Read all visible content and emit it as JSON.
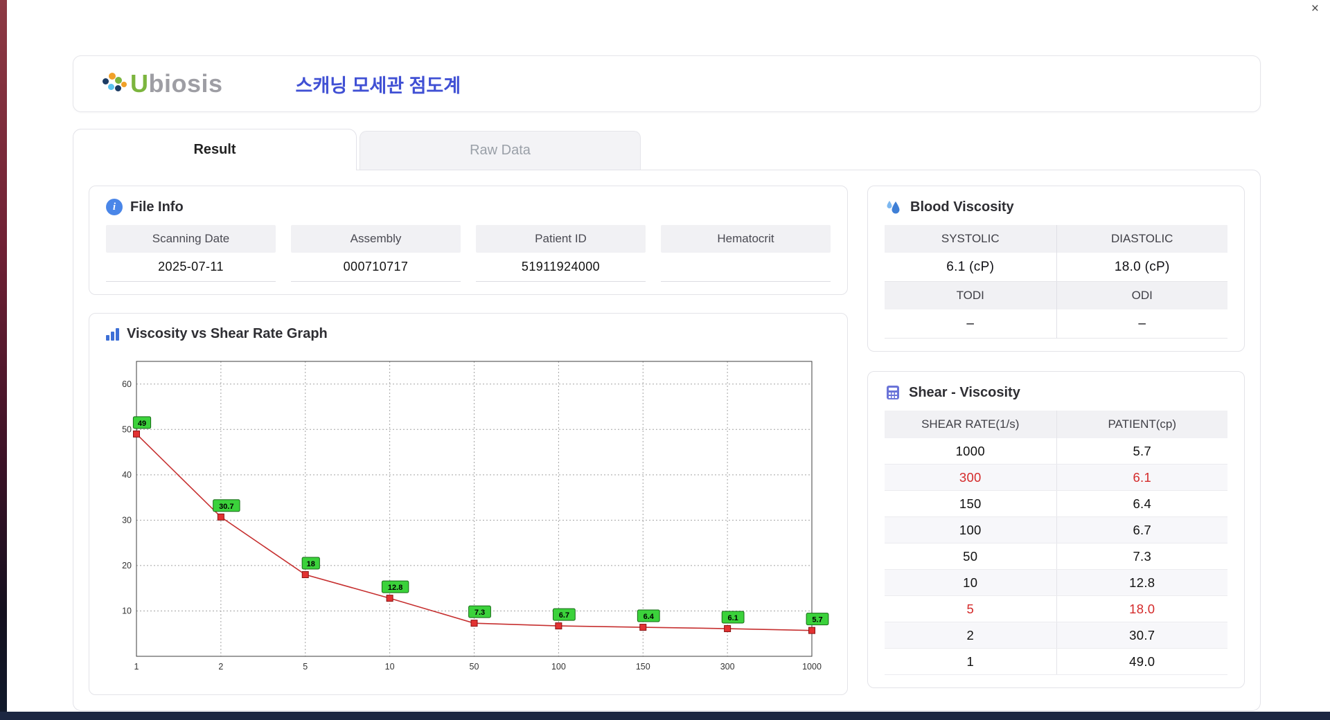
{
  "window": {
    "close_icon": "×"
  },
  "icons": {
    "info": "i"
  },
  "header": {
    "logo_u": "U",
    "logo_rest": "biosis",
    "title": "스캐닝 모세관 점도계"
  },
  "tabs": [
    {
      "label": "Result",
      "active": true
    },
    {
      "label": "Raw Data",
      "active": false
    }
  ],
  "file_info": {
    "title": "File Info",
    "fields": [
      {
        "label": "Scanning Date",
        "value": "2025-07-11"
      },
      {
        "label": "Assembly",
        "value": "000710717"
      },
      {
        "label": "Patient ID",
        "value": "51911924000"
      },
      {
        "label": "Hematocrit",
        "value": ""
      }
    ]
  },
  "blood_viscosity": {
    "title": "Blood Viscosity",
    "rows": [
      {
        "headers": [
          "SYSTOLIC",
          "DIASTOLIC"
        ],
        "values": [
          "6.1 (cP)",
          "18.0 (cP)"
        ]
      },
      {
        "headers": [
          "TODI",
          "ODI"
        ],
        "values": [
          "–",
          "–"
        ]
      }
    ]
  },
  "shear_viscosity": {
    "title": "Shear - Viscosity",
    "columns": [
      "SHEAR RATE(1/s)",
      "PATIENT(cp)"
    ],
    "rows": [
      {
        "shear": "1000",
        "patient": "5.7",
        "highlight": false
      },
      {
        "shear": "300",
        "patient": "6.1",
        "highlight": true
      },
      {
        "shear": "150",
        "patient": "6.4",
        "highlight": false
      },
      {
        "shear": "100",
        "patient": "6.7",
        "highlight": false
      },
      {
        "shear": "50",
        "patient": "7.3",
        "highlight": false
      },
      {
        "shear": "10",
        "patient": "12.8",
        "highlight": false
      },
      {
        "shear": "5",
        "patient": "18.0",
        "highlight": true
      },
      {
        "shear": "2",
        "patient": "30.7",
        "highlight": false
      },
      {
        "shear": "1",
        "patient": "49.0",
        "highlight": false
      }
    ]
  },
  "graph": {
    "title": "Viscosity vs Shear Rate Graph"
  },
  "chart_data": {
    "type": "line",
    "x": [
      "1",
      "2",
      "5",
      "10",
      "50",
      "100",
      "150",
      "300",
      "1000"
    ],
    "x_scale": "categorical",
    "values": [
      49,
      30.7,
      18,
      12.8,
      7.3,
      6.7,
      6.4,
      6.1,
      5.7
    ],
    "point_labels": [
      "49",
      "30.7",
      "18",
      "12.8",
      "7.3",
      "6.7",
      "6.4",
      "6.1",
      "5.7"
    ],
    "title": "Viscosity vs Shear Rate Graph",
    "xlabel": "",
    "ylabel": "",
    "ylim": [
      0,
      65
    ],
    "yticks": [
      10,
      20,
      30,
      40,
      50,
      60
    ],
    "grid": true,
    "legend": false,
    "line_color": "#c62f2f",
    "marker_color": "#e23232",
    "label_bg": "#3bd23b"
  }
}
